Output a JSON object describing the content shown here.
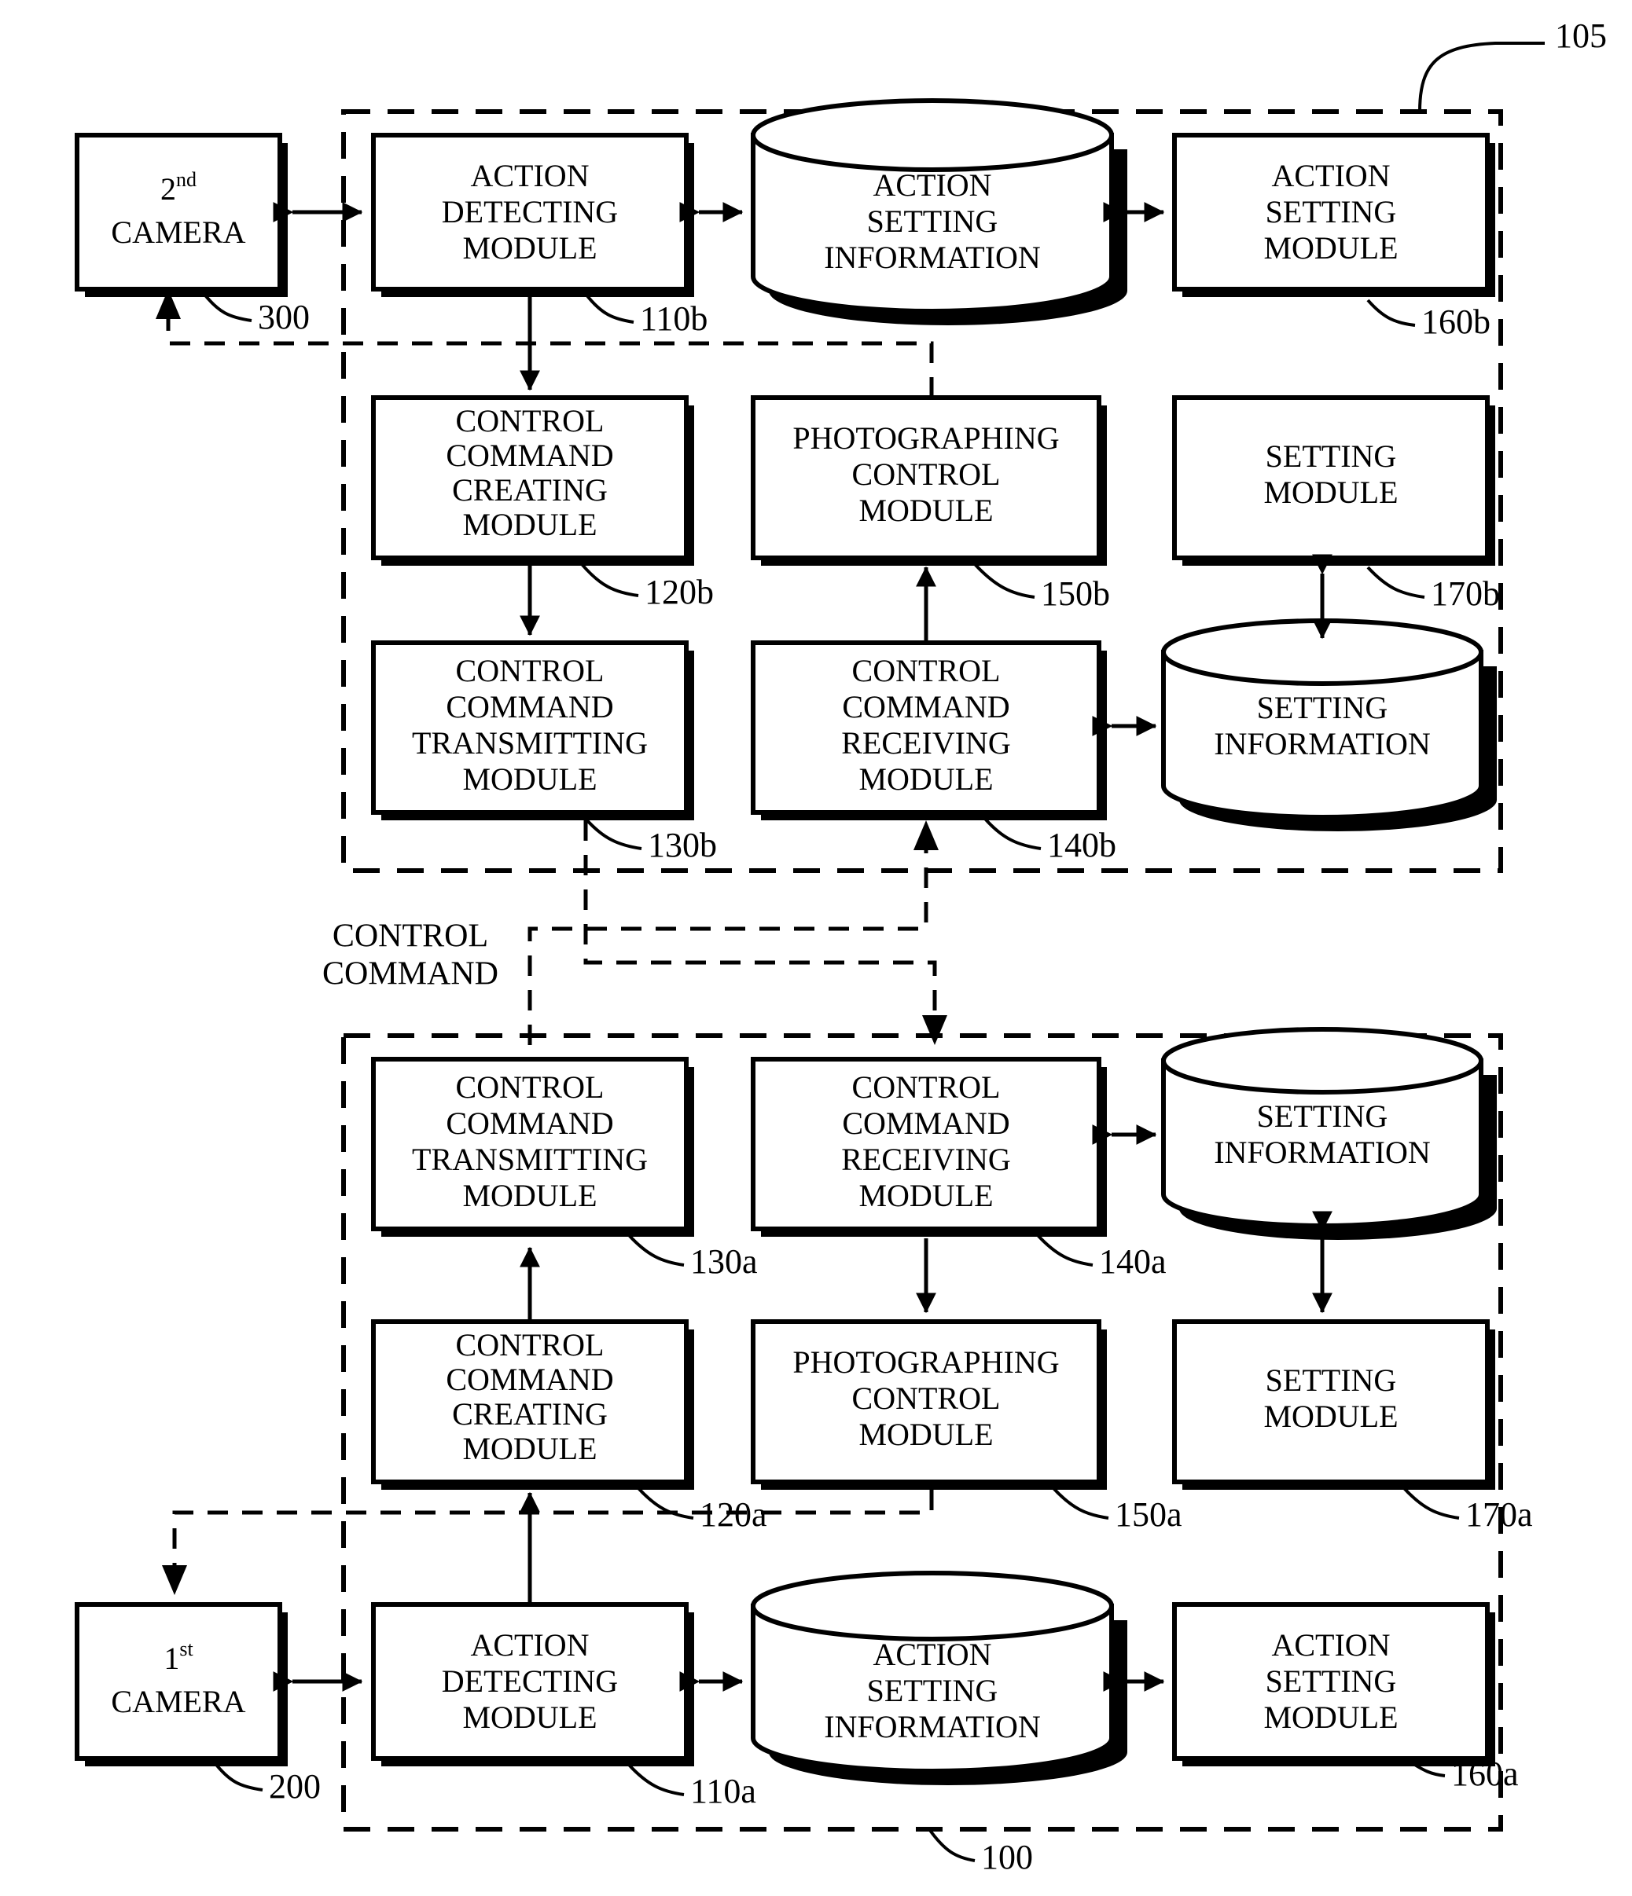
{
  "figure": {
    "title": "Camera control system block diagram",
    "type": "patent-block-diagram"
  },
  "refs": {
    "r105": "105",
    "r300": "300",
    "r200": "200",
    "r100": "100",
    "r110b": "110b",
    "r120b": "120b",
    "r130b": "130b",
    "r140b": "140b",
    "r150b": "150b",
    "r160b": "160b",
    "r170b": "170b",
    "r110a": "110a",
    "r120a": "120a",
    "r130a": "130a",
    "r140a": "140a",
    "r150a": "150a",
    "r160a": "160a",
    "r170a": "170a"
  },
  "cameras": {
    "second": {
      "line1_num": "2",
      "line1_sup": "nd",
      "line2": "CAMERA"
    },
    "first": {
      "line1_num": "1",
      "line1_sup": "st",
      "line2": "CAMERA"
    }
  },
  "link_label": {
    "line1": "CONTROL",
    "line2": "COMMAND"
  },
  "upper_unit": {
    "action_detecting": [
      "ACTION",
      "DETECTING",
      "MODULE"
    ],
    "action_setting_info": [
      "ACTION",
      "SETTING",
      "INFORMATION"
    ],
    "action_setting_mod": [
      "ACTION",
      "SETTING",
      "MODULE"
    ],
    "cmd_creating": [
      "CONTROL",
      "COMMAND",
      "CREATING",
      "MODULE"
    ],
    "photographing_ctrl": [
      "PHOTOGRAPHING",
      "CONTROL",
      "MODULE"
    ],
    "setting_module": [
      "SETTING",
      "MODULE"
    ],
    "cmd_transmitting": [
      "CONTROL",
      "COMMAND",
      "TRANSMITTING",
      "MODULE"
    ],
    "cmd_receiving": [
      "CONTROL",
      "COMMAND",
      "RECEIVING",
      "MODULE"
    ],
    "setting_info": [
      "SETTING",
      "INFORMATION"
    ]
  },
  "lower_unit": {
    "cmd_transmitting": [
      "CONTROL",
      "COMMAND",
      "TRANSMITTING",
      "MODULE"
    ],
    "cmd_receiving": [
      "CONTROL",
      "COMMAND",
      "RECEIVING",
      "MODULE"
    ],
    "setting_info": [
      "SETTING",
      "INFORMATION"
    ],
    "cmd_creating": [
      "CONTROL",
      "COMMAND",
      "CREATING",
      "MODULE"
    ],
    "photographing_ctrl": [
      "PHOTOGRAPHING",
      "CONTROL",
      "MODULE"
    ],
    "setting_module": [
      "SETTING",
      "MODULE"
    ],
    "action_detecting": [
      "ACTION",
      "DETECTING",
      "MODULE"
    ],
    "action_setting_info": [
      "ACTION",
      "SETTING",
      "INFORMATION"
    ],
    "action_setting_mod": [
      "ACTION",
      "SETTING",
      "MODULE"
    ]
  },
  "colors": {
    "line": "#000000",
    "fill": "#ffffff"
  }
}
